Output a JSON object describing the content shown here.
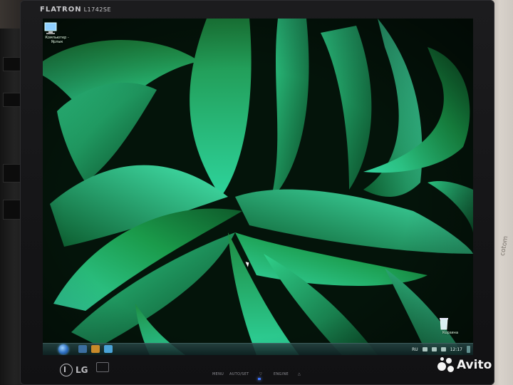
{
  "monitor": {
    "brand": "FLATRON",
    "model": "L1742SE",
    "manufacturer": "LG",
    "controls": [
      "MENU",
      "AUTO/SET",
      "▽",
      "ENGINE",
      "△"
    ]
  },
  "desktop": {
    "icons": [
      {
        "name": "computer-shortcut",
        "label": "Компьютер - Ярлык",
        "icon": "computer-icon"
      },
      {
        "name": "recycle-bin",
        "label": "Корзина",
        "icon": "recycle-bin-icon"
      }
    ],
    "wallpaper": "green leaves"
  },
  "taskbar": {
    "language": "RU",
    "clock": "12:17"
  },
  "wall": {
    "text": "cotom"
  },
  "watermark": {
    "text": "Avito"
  },
  "colors": {
    "bezel": "#151517",
    "leaf_light": "#3fe0a0",
    "leaf_dark": "#0d5a2a",
    "power_led": "#3d74ff"
  }
}
